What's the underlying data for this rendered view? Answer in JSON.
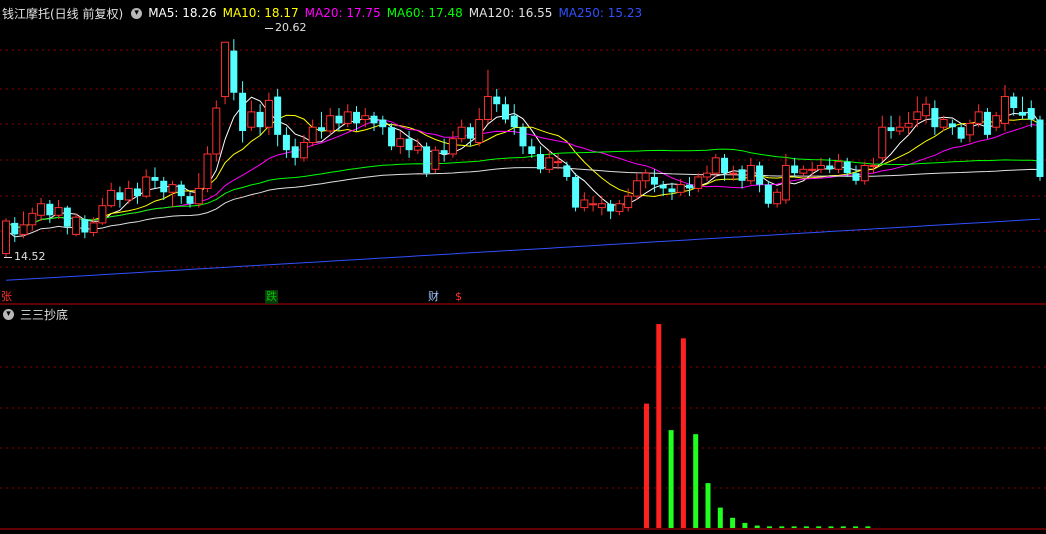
{
  "top_panel": {
    "stock_title": "钱江摩托(日线 前复权)",
    "dropdown_icon": "chevron-down-icon",
    "ma_legend": [
      {
        "label": "MA5: 18.26",
        "color": "#ffffff"
      },
      {
        "label": "MA10: 18.17",
        "color": "#ffff00"
      },
      {
        "label": "MA20: 17.75",
        "color": "#ff00ff"
      },
      {
        "label": "MA60: 17.48",
        "color": "#00ff00"
      },
      {
        "label": "MA120: 16.55",
        "color": "#e0e0e0"
      },
      {
        "label": "MA250: 15.23",
        "color": "#3050ff"
      }
    ],
    "high_label": "20.62",
    "low_label": "14.52",
    "event_markers": [
      {
        "text": "张",
        "color": "#ff3030"
      },
      {
        "text": "跌",
        "color": "#00c000"
      },
      {
        "text": "财",
        "color": "#a0c8ff"
      },
      {
        "text": "$",
        "color": "#ff3030"
      }
    ]
  },
  "bottom_panel": {
    "indicator_title": "三三抄底",
    "dropdown_icon": "chevron-down-icon",
    "bars": [
      {
        "value": 0.61,
        "color": "#ff2020"
      },
      {
        "value": 1.0,
        "color": "#ff2020"
      },
      {
        "value": 0.48,
        "color": "#20ff20"
      },
      {
        "value": 0.93,
        "color": "#ff2020"
      },
      {
        "value": 0.46,
        "color": "#20ff20"
      },
      {
        "value": 0.22,
        "color": "#20ff20"
      },
      {
        "value": 0.1,
        "color": "#20ff20"
      },
      {
        "value": 0.05,
        "color": "#20ff20"
      },
      {
        "value": 0.025,
        "color": "#20ff20"
      },
      {
        "value": 0.012,
        "color": "#20ff20"
      },
      {
        "value": 0.008,
        "color": "#20ff20"
      },
      {
        "value": 0.008,
        "color": "#20ff20"
      },
      {
        "value": 0.008,
        "color": "#20ff20"
      },
      {
        "value": 0.008,
        "color": "#20ff20"
      },
      {
        "value": 0.008,
        "color": "#20ff20"
      },
      {
        "value": 0.008,
        "color": "#20ff20"
      },
      {
        "value": 0.008,
        "color": "#20ff20"
      },
      {
        "value": 0.008,
        "color": "#20ff20"
      },
      {
        "value": 0.008,
        "color": "#20ff20"
      }
    ]
  },
  "candles": [
    [
      15.1,
      15.95,
      15.0,
      16.02
    ],
    [
      15.9,
      15.6,
      15.4,
      16.05
    ],
    [
      15.6,
      15.85,
      15.5,
      16.2
    ],
    [
      15.85,
      16.15,
      15.7,
      16.3
    ],
    [
      16.1,
      16.4,
      15.95,
      16.55
    ],
    [
      16.4,
      16.1,
      15.9,
      16.5
    ],
    [
      16.1,
      16.3,
      16.0,
      16.5
    ],
    [
      16.3,
      15.8,
      15.6,
      16.35
    ],
    [
      15.6,
      16.05,
      15.55,
      16.15
    ],
    [
      16.0,
      15.65,
      15.5,
      16.1
    ],
    [
      15.65,
      15.9,
      15.55,
      16.05
    ],
    [
      15.9,
      16.35,
      15.85,
      16.55
    ],
    [
      16.35,
      16.75,
      16.3,
      16.95
    ],
    [
      16.7,
      16.5,
      16.3,
      16.85
    ],
    [
      16.5,
      16.8,
      16.4,
      17.0
    ],
    [
      16.8,
      16.6,
      16.4,
      16.95
    ],
    [
      16.6,
      17.1,
      16.55,
      17.3
    ],
    [
      17.1,
      17.0,
      16.8,
      17.35
    ],
    [
      17.0,
      16.7,
      16.5,
      17.1
    ],
    [
      16.7,
      16.9,
      16.3,
      17.0
    ],
    [
      16.9,
      16.6,
      16.4,
      17.0
    ],
    [
      16.6,
      16.4,
      16.3,
      16.7
    ],
    [
      16.4,
      16.8,
      16.3,
      17.2
    ],
    [
      16.8,
      17.7,
      16.7,
      17.9
    ],
    [
      17.7,
      18.9,
      17.5,
      19.1
    ],
    [
      19.2,
      20.62,
      19.0,
      20.62
    ],
    [
      20.4,
      19.3,
      19.1,
      20.7
    ],
    [
      19.3,
      18.3,
      18.0,
      19.6
    ],
    [
      18.4,
      18.8,
      18.3,
      19.1
    ],
    [
      18.8,
      18.4,
      18.2,
      19.0
    ],
    [
      18.4,
      19.1,
      18.2,
      19.3
    ],
    [
      19.2,
      18.2,
      17.9,
      19.4
    ],
    [
      18.2,
      17.8,
      17.6,
      18.4
    ],
    [
      17.9,
      17.6,
      17.4,
      18.1
    ],
    [
      17.6,
      18.0,
      17.5,
      18.2
    ],
    [
      18.0,
      18.4,
      17.9,
      18.6
    ],
    [
      18.4,
      18.3,
      18.1,
      18.8
    ],
    [
      18.3,
      18.7,
      18.2,
      18.9
    ],
    [
      18.7,
      18.5,
      18.3,
      18.9
    ],
    [
      18.5,
      18.8,
      18.4,
      19.0
    ],
    [
      18.8,
      18.5,
      18.3,
      18.95
    ],
    [
      18.6,
      18.7,
      18.4,
      18.9
    ],
    [
      18.7,
      18.5,
      18.3,
      18.8
    ],
    [
      18.6,
      18.4,
      18.2,
      18.7
    ],
    [
      18.4,
      17.9,
      17.8,
      18.5
    ],
    [
      17.9,
      18.1,
      17.7,
      18.3
    ],
    [
      18.1,
      17.8,
      17.6,
      18.3
    ],
    [
      17.8,
      17.9,
      17.7,
      18.1
    ],
    [
      17.9,
      17.2,
      17.1,
      18.0
    ],
    [
      17.3,
      17.8,
      17.2,
      17.9
    ],
    [
      17.8,
      17.7,
      17.5,
      18.1
    ],
    [
      17.7,
      18.1,
      17.6,
      18.3
    ],
    [
      18.1,
      18.4,
      18.0,
      18.6
    ],
    [
      18.4,
      18.1,
      17.9,
      18.5
    ],
    [
      18.0,
      18.6,
      17.9,
      18.9
    ],
    [
      18.6,
      19.2,
      18.5,
      19.9
    ],
    [
      19.2,
      19.0,
      18.8,
      19.4
    ],
    [
      19.0,
      18.6,
      18.5,
      19.2
    ],
    [
      18.7,
      18.4,
      18.2,
      19.0
    ],
    [
      18.4,
      17.9,
      17.7,
      18.5
    ],
    [
      17.9,
      17.7,
      17.6,
      18.1
    ],
    [
      17.7,
      17.3,
      17.2,
      17.9
    ],
    [
      17.3,
      17.6,
      17.2,
      17.8
    ],
    [
      17.5,
      17.5,
      17.3,
      17.7
    ],
    [
      17.4,
      17.1,
      17.0,
      17.5
    ],
    [
      17.1,
      16.3,
      16.2,
      17.2
    ],
    [
      16.3,
      16.5,
      16.2,
      16.7
    ],
    [
      16.4,
      16.4,
      16.2,
      16.6
    ],
    [
      16.3,
      16.4,
      16.1,
      16.6
    ],
    [
      16.4,
      16.2,
      16.0,
      16.5
    ],
    [
      16.2,
      16.4,
      16.1,
      16.5
    ],
    [
      16.3,
      16.6,
      16.2,
      16.8
    ],
    [
      16.6,
      17.0,
      16.5,
      17.2
    ],
    [
      17.0,
      17.2,
      16.8,
      17.3
    ],
    [
      17.1,
      16.9,
      16.7,
      17.3
    ],
    [
      16.9,
      16.8,
      16.6,
      17.0
    ],
    [
      16.8,
      16.7,
      16.5,
      16.95
    ],
    [
      16.7,
      16.9,
      16.6,
      17.05
    ],
    [
      16.9,
      16.8,
      16.6,
      17.1
    ],
    [
      16.8,
      17.1,
      16.7,
      17.2
    ],
    [
      17.1,
      17.2,
      17.0,
      17.4
    ],
    [
      17.2,
      17.6,
      17.1,
      17.7
    ],
    [
      17.6,
      17.2,
      17.0,
      17.7
    ],
    [
      17.2,
      17.2,
      17.0,
      17.4
    ],
    [
      17.3,
      17.0,
      16.8,
      17.4
    ],
    [
      17.0,
      17.4,
      16.9,
      17.6
    ],
    [
      17.4,
      16.9,
      16.7,
      17.5
    ],
    [
      16.9,
      16.4,
      16.3,
      17.0
    ],
    [
      16.4,
      16.7,
      16.3,
      16.8
    ],
    [
      16.5,
      17.4,
      16.4,
      17.7
    ],
    [
      17.4,
      17.2,
      17.1,
      17.6
    ],
    [
      17.2,
      17.3,
      17.1,
      17.4
    ],
    [
      17.3,
      17.3,
      17.1,
      17.5
    ],
    [
      17.3,
      17.4,
      17.2,
      17.6
    ],
    [
      17.4,
      17.3,
      17.2,
      17.6
    ],
    [
      17.3,
      17.5,
      17.2,
      17.7
    ],
    [
      17.5,
      17.2,
      17.1,
      17.6
    ],
    [
      17.2,
      17.0,
      16.9,
      17.4
    ],
    [
      17.0,
      17.4,
      16.9,
      17.5
    ],
    [
      17.4,
      17.4,
      17.2,
      17.6
    ],
    [
      17.6,
      18.4,
      17.5,
      18.7
    ],
    [
      18.4,
      18.3,
      18.1,
      18.7
    ],
    [
      18.3,
      18.4,
      18.2,
      18.7
    ],
    [
      18.4,
      18.5,
      18.2,
      18.8
    ],
    [
      18.6,
      18.8,
      18.4,
      19.2
    ],
    [
      18.7,
      19.0,
      18.5,
      19.2
    ],
    [
      18.9,
      18.4,
      18.2,
      19.1
    ],
    [
      18.4,
      18.6,
      18.3,
      18.7
    ],
    [
      18.5,
      18.4,
      18.2,
      18.6
    ],
    [
      18.4,
      18.1,
      18.0,
      18.5
    ],
    [
      18.2,
      18.5,
      18.0,
      18.6
    ],
    [
      18.5,
      18.8,
      18.4,
      19.0
    ],
    [
      18.8,
      18.2,
      18.1,
      18.9
    ],
    [
      18.4,
      18.7,
      18.3,
      18.8
    ],
    [
      18.5,
      19.2,
      18.3,
      19.5
    ],
    [
      19.2,
      18.9,
      18.7,
      19.3
    ],
    [
      18.8,
      18.7,
      18.6,
      19.2
    ],
    [
      18.9,
      18.6,
      18.4,
      19.1
    ],
    [
      18.6,
      17.1,
      17.0,
      18.7
    ]
  ]
}
